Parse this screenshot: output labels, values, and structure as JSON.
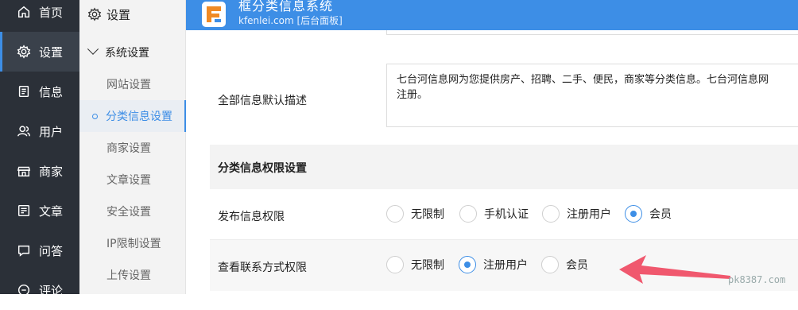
{
  "nav": {
    "items": [
      {
        "label": "首页",
        "icon": "home-icon"
      },
      {
        "label": "设置",
        "icon": "gear-icon"
      },
      {
        "label": "信息",
        "icon": "document-icon"
      },
      {
        "label": "用户",
        "icon": "user-icon"
      },
      {
        "label": "商家",
        "icon": "store-icon"
      },
      {
        "label": "文章",
        "icon": "article-icon"
      },
      {
        "label": "问答",
        "icon": "chat-icon"
      },
      {
        "label": "评论",
        "icon": "comment-icon"
      }
    ],
    "active_index": 1
  },
  "subnav": {
    "title": "设置",
    "group": "系统设置",
    "items": [
      "网站设置",
      "分类信息设置",
      "商家设置",
      "文章设置",
      "安全设置",
      "IP限制设置",
      "上传设置"
    ],
    "active_index": 1
  },
  "header": {
    "title": "框分类信息系统",
    "subtitle": "kfenlei.com [后台面板]"
  },
  "form": {
    "desc_label": "全部信息默认描述",
    "desc_value": "七台河信息网为您提供房产、招聘、二手、便民，商家等分类信息。七台河信息网\n注册。",
    "section_title": "分类信息权限设置",
    "publish": {
      "label": "发布信息权限",
      "options": [
        "无限制",
        "手机认证",
        "注册用户",
        "会员"
      ],
      "selected": "会员"
    },
    "contact": {
      "label": "查看联系方式权限",
      "options": [
        "无限制",
        "注册用户",
        "会员"
      ],
      "selected": "注册用户"
    }
  },
  "watermark": "pk8387.com",
  "colors": {
    "accent": "#3d8ee6",
    "nav_bg": "#2b3038",
    "arrow": "#f0586e"
  }
}
